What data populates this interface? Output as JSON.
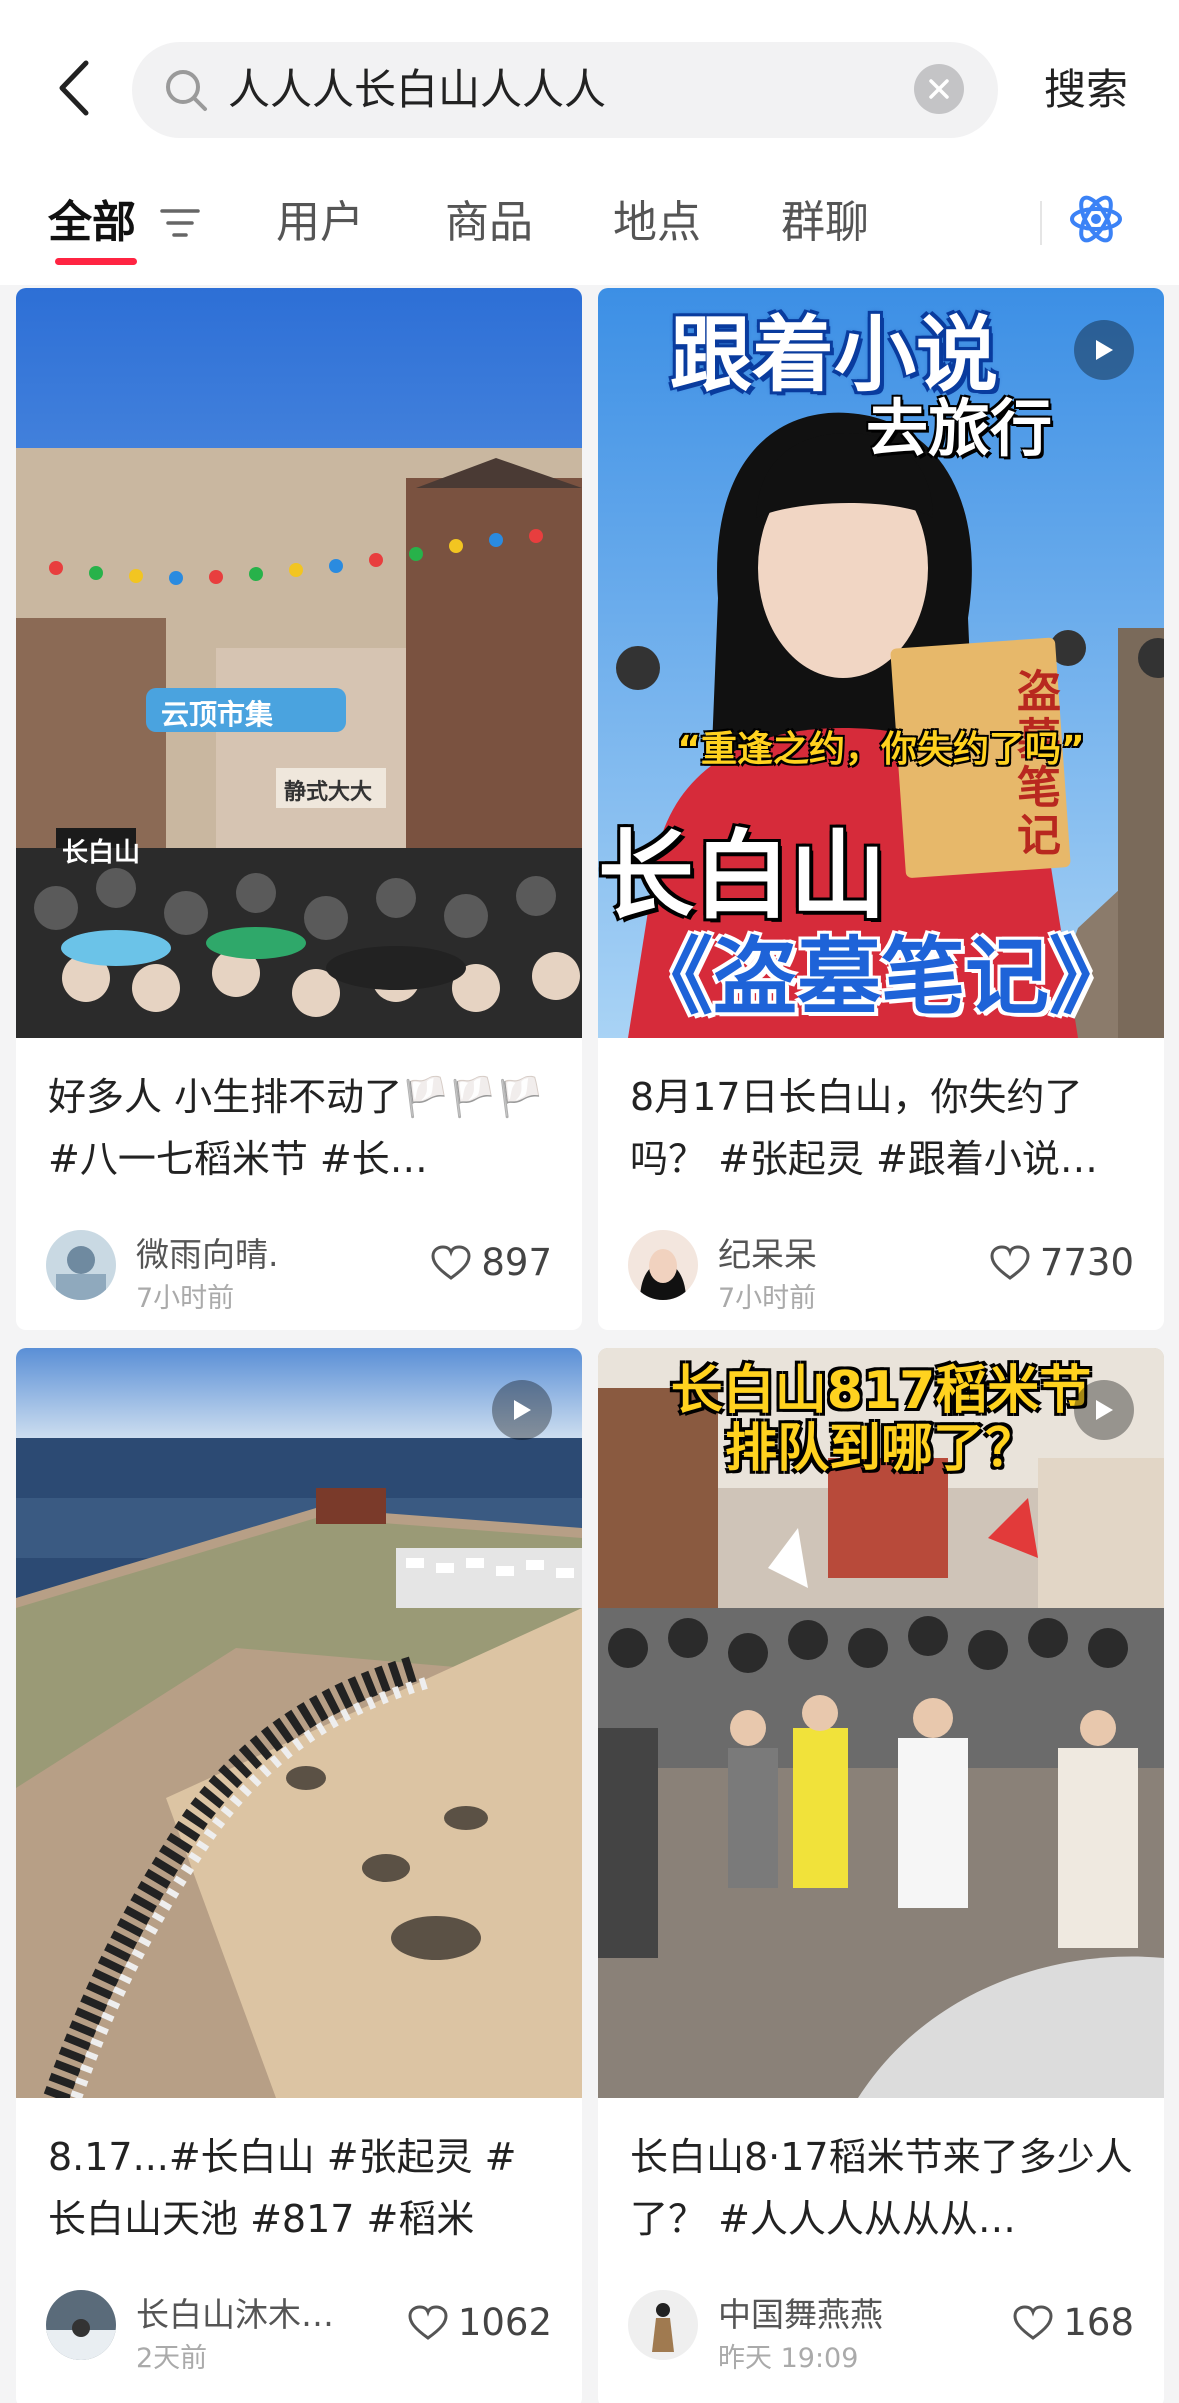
{
  "header": {
    "search_query": "人人人长白山人人人",
    "search_button": "搜索"
  },
  "tabs": [
    {
      "label": "全部",
      "active": true
    },
    {
      "label": "用户",
      "active": false
    },
    {
      "label": "商品",
      "active": false
    },
    {
      "label": "地点",
      "active": false
    },
    {
      "label": "群聊",
      "active": false
    }
  ],
  "colors": {
    "accent": "#ff2442",
    "ai_icon": "#3b82f6"
  },
  "cards": [
    {
      "title": "好多人 小生排不动了🏳️🏳️🏳️ #八一七稻米节 #长…",
      "author": "微雨向晴.",
      "time": "7小时前",
      "likes": "897",
      "is_video": false,
      "image_signs": {
        "shop": "云顶市集",
        "left": "长白山",
        "right": "静式大大"
      }
    },
    {
      "title": "8月17日长白山，你失约了吗？ #张起灵 #跟着小说…",
      "author": "纪呆呆",
      "time": "7小时前",
      "likes": "7730",
      "is_video": true,
      "overlay": {
        "line1": "跟着小说",
        "line2": "去旅行",
        "line3": "“重逢之约，你失约了吗”",
        "line4": "长白山",
        "line5": "《盗墓笔记》",
        "book": "盗墓笔记"
      }
    },
    {
      "title": "8.17...#长白山 #张起灵 #长白山天池 #817 #稻米",
      "author": "长白山沐木…",
      "time": "2天前",
      "likes": "1062",
      "is_video": true
    },
    {
      "title": "长白山8·17稻米节来了多少人了？ #人人人从从从…",
      "author": "中国舞燕燕",
      "time": "昨天 19:09",
      "likes": "168",
      "is_video": true,
      "overlay": {
        "line1": "长白山817稻米节",
        "line2": "排队到哪了？"
      }
    }
  ]
}
